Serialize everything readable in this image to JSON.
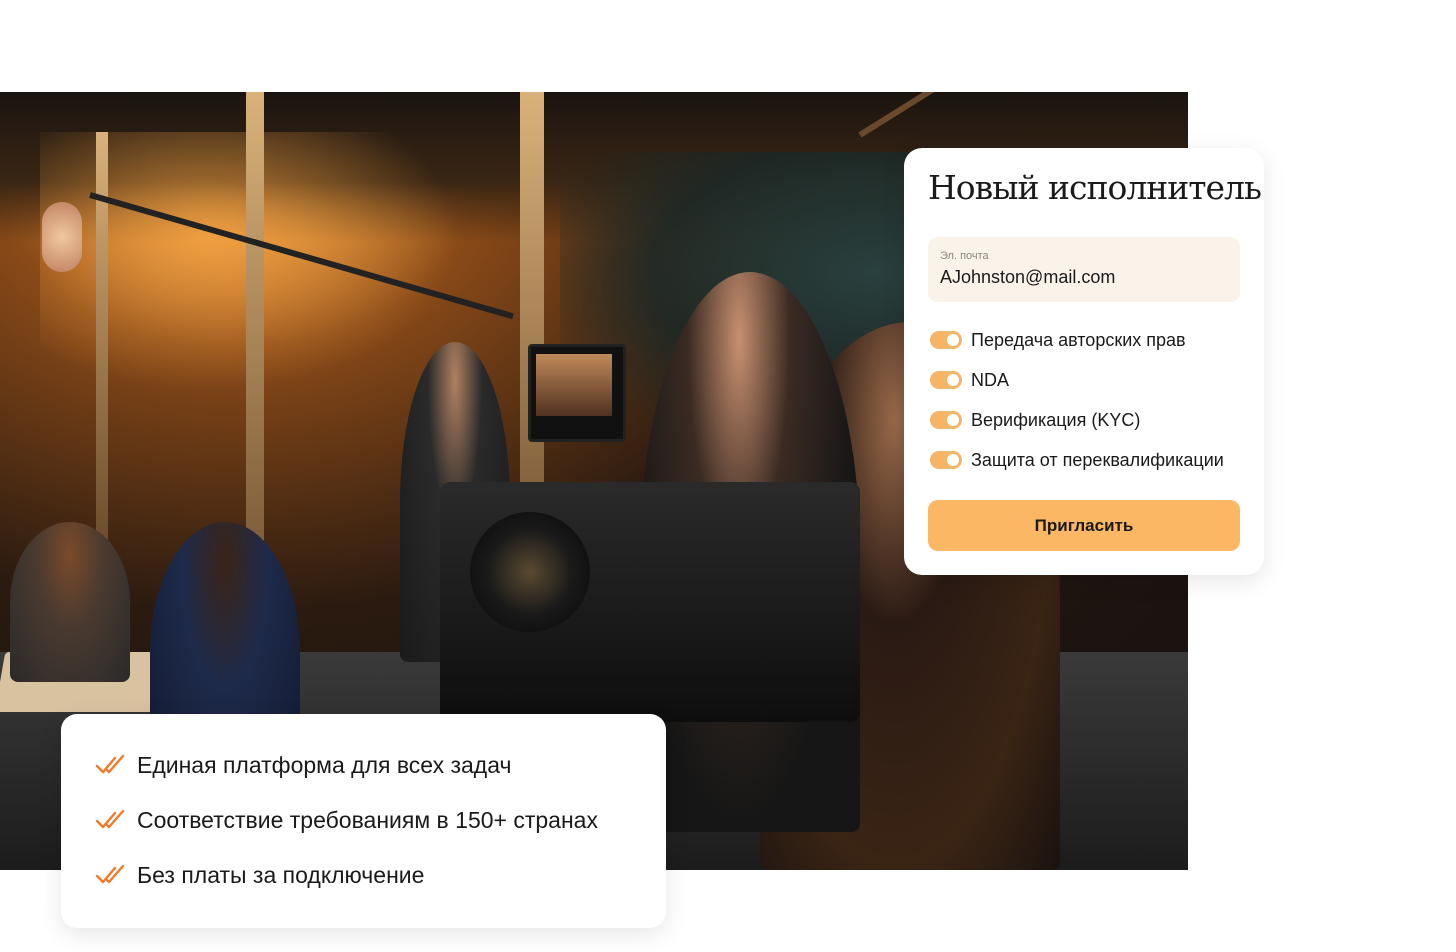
{
  "invite_card": {
    "title": "Новый исполнитель",
    "email": {
      "label": "Эл. почта",
      "value": "AJohnston@mail.com"
    },
    "toggles": [
      {
        "label": "Передача авторских прав",
        "on": true
      },
      {
        "label": "NDA",
        "on": true
      },
      {
        "label": "Верификация (KYC)",
        "on": true
      },
      {
        "label": "Защита от переквалификации",
        "on": true
      }
    ],
    "button_label": "Пригласить"
  },
  "features": [
    {
      "text": "Единая платформа для всех задач",
      "icon": "double-check-icon"
    },
    {
      "text": "Соответствие требованиям в 150+ странах",
      "icon": "double-check-icon"
    },
    {
      "text": "Без платы за подключение",
      "icon": "double-check-icon"
    }
  ],
  "colors": {
    "accent": "#fbb764",
    "toggle_on": "#f5b466",
    "field_bg": "#fbf2e9",
    "check": "#f07a2a"
  }
}
